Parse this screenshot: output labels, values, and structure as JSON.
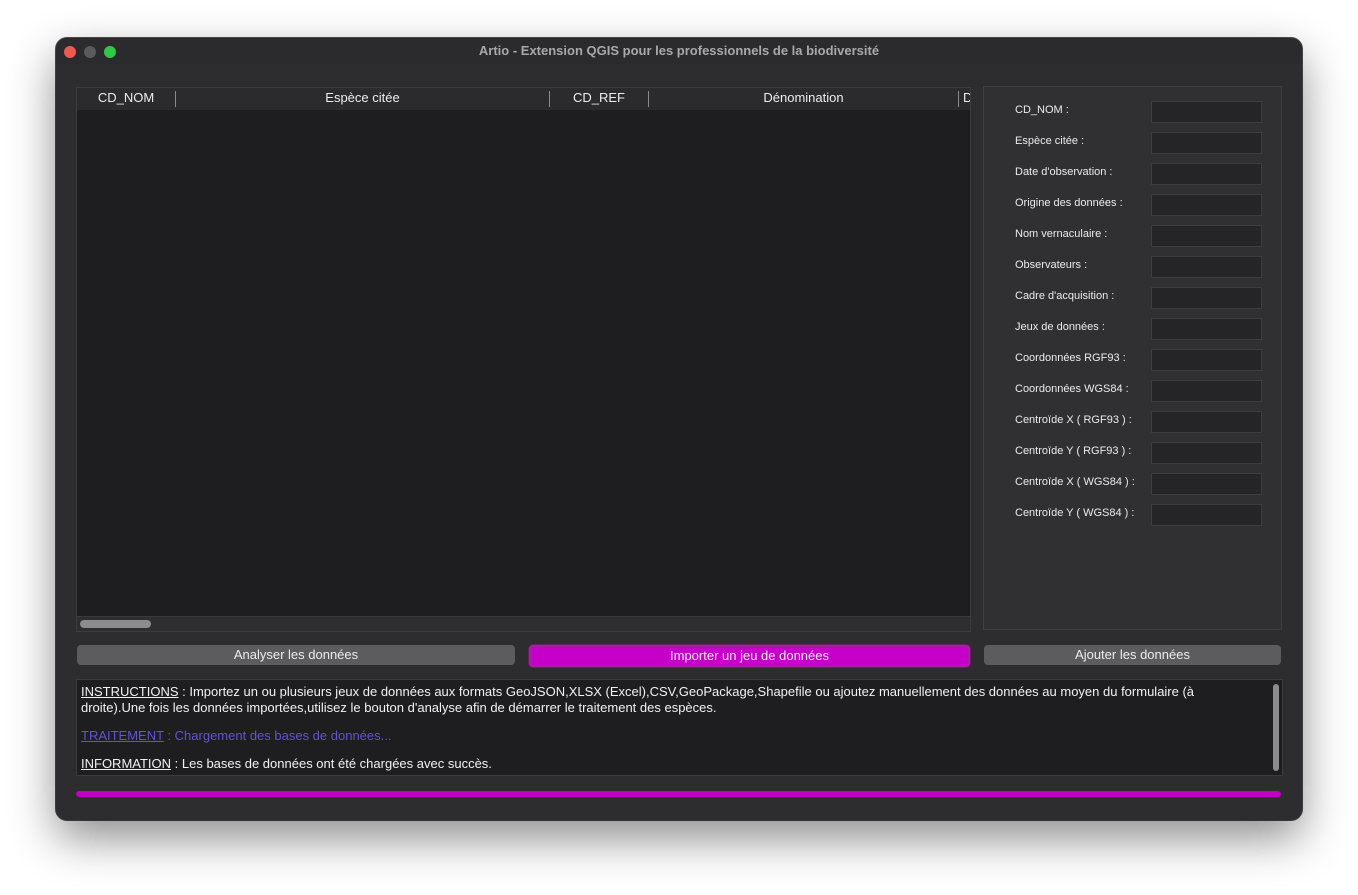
{
  "window": {
    "title": "Artio - Extension QGIS pour les professionnels de la biodiversité"
  },
  "table": {
    "columns": [
      {
        "label": "CD_NOM"
      },
      {
        "label": "Espèce citée"
      },
      {
        "label": "CD_REF"
      },
      {
        "label": "Dénomination"
      },
      {
        "label": "D"
      }
    ]
  },
  "form": {
    "fields": [
      {
        "label": "CD_NOM :",
        "value": ""
      },
      {
        "label": "Espèce citée :",
        "value": ""
      },
      {
        "label": "Date d'observation :",
        "value": ""
      },
      {
        "label": "Origine des données :",
        "value": ""
      },
      {
        "label": "Nom vernaculaire :",
        "value": ""
      },
      {
        "label": "Observateurs :",
        "value": ""
      },
      {
        "label": "Cadre d'acquisition :",
        "value": ""
      },
      {
        "label": "Jeux de données :",
        "value": ""
      },
      {
        "label": "Coordonnées RGF93 :",
        "value": ""
      },
      {
        "label": "Coordonnées WGS84 :",
        "value": ""
      },
      {
        "label": "Centroïde X ( RGF93 ) :",
        "value": ""
      },
      {
        "label": "Centroïde Y ( RGF93 ) :",
        "value": ""
      },
      {
        "label": "Centroïde X ( WGS84 ) :",
        "value": ""
      },
      {
        "label": "Centroïde Y ( WGS84 ) :",
        "value": ""
      }
    ]
  },
  "buttons": {
    "analyse": "Analyser les données",
    "import": "Importer un jeu de données",
    "add": "Ajouter les données"
  },
  "log": {
    "instructions_tag": "INSTRUCTIONS",
    "instructions_text": " : Importez un ou plusieurs jeux de données aux formats GeoJSON,XLSX (Excel),CSV,GeoPackage,Shapefile ou ajoutez manuellement des données au moyen du formulaire (à droite).Une fois les données importées,utilisez le bouton d'analyse afin de démarrer le traitement des espèces.",
    "traitement_tag": "TRAITEMENT",
    "traitement_text": " : Chargement des bases de données...",
    "information_tag": "INFORMATION",
    "information_text": " : Les bases de données ont été chargées avec succès."
  },
  "colors": {
    "accent": "#c700c9",
    "traitement": "#5f54d9",
    "window_bg": "#2d2c2e"
  }
}
